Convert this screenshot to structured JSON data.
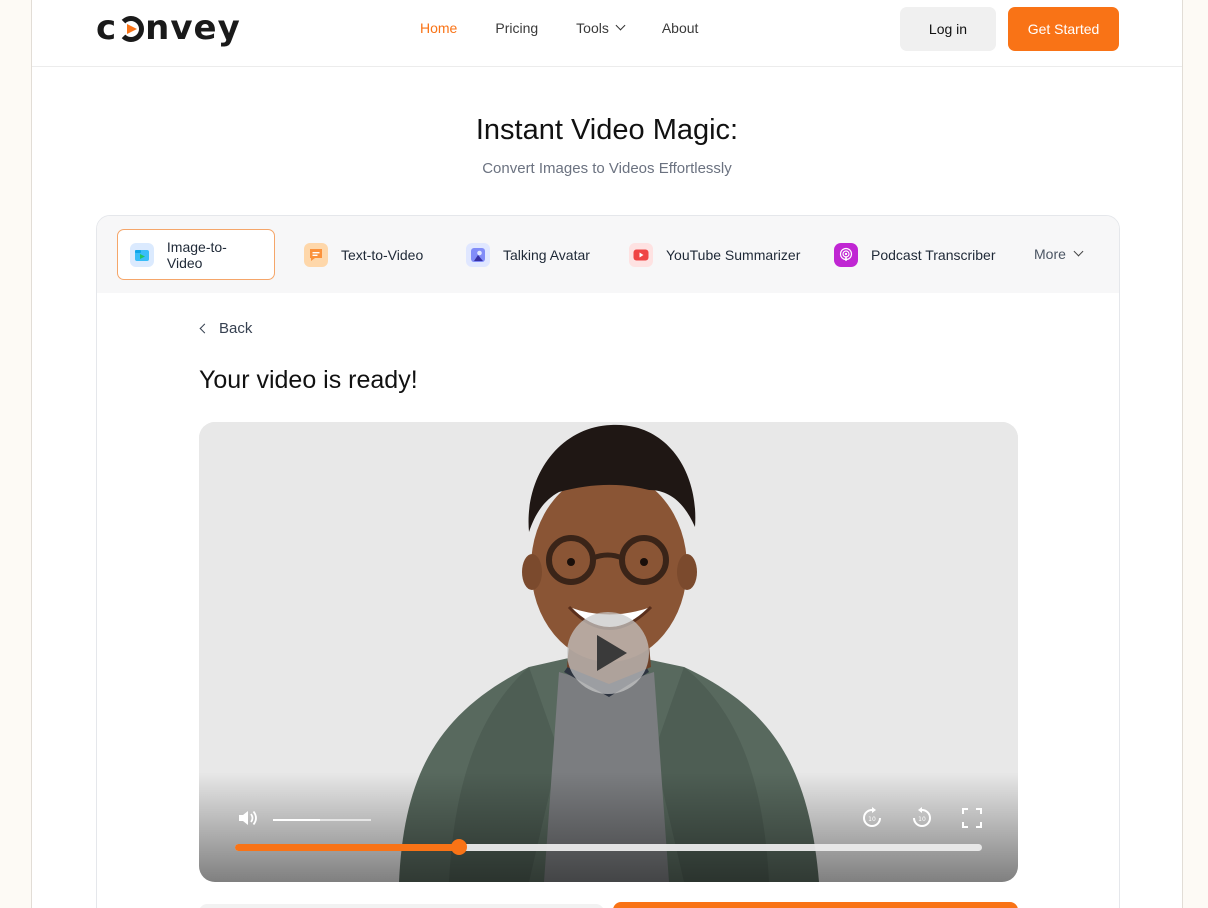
{
  "brand": {
    "name": "convey",
    "accent": "#f97316"
  },
  "nav": {
    "items": [
      {
        "label": "Home",
        "active": true
      },
      {
        "label": "Pricing",
        "active": false
      },
      {
        "label": "Tools",
        "active": false,
        "dropdown": true
      },
      {
        "label": "About",
        "active": false
      }
    ],
    "login_label": "Log in",
    "get_started_label": "Get Started"
  },
  "hero": {
    "title": "Instant Video Magic:",
    "subtitle": "Convert Images to Videos Effortlessly"
  },
  "tools": {
    "tabs": [
      {
        "label": "Image-to-Video",
        "icon": "image-video-icon",
        "active": true,
        "color": "#38bdf8"
      },
      {
        "label": "Text-to-Video",
        "icon": "text-chat-icon",
        "active": false,
        "color": "#fb923c"
      },
      {
        "label": "Talking Avatar",
        "icon": "avatar-icon",
        "active": false,
        "color": "#6366f1"
      },
      {
        "label": "YouTube Summarizer",
        "icon": "youtube-icon",
        "active": false,
        "color": "#ef4444"
      },
      {
        "label": "Podcast Transcriber",
        "icon": "podcast-icon",
        "active": false,
        "color": "#c026d3"
      }
    ],
    "more_label": "More"
  },
  "result": {
    "back_label": "Back",
    "title": "Your video is ready!"
  },
  "player": {
    "progress": 0.3,
    "volume": 0.48,
    "controls": [
      "volume-icon",
      "rewind-10-icon",
      "forward-10-icon",
      "fullscreen-icon"
    ]
  }
}
